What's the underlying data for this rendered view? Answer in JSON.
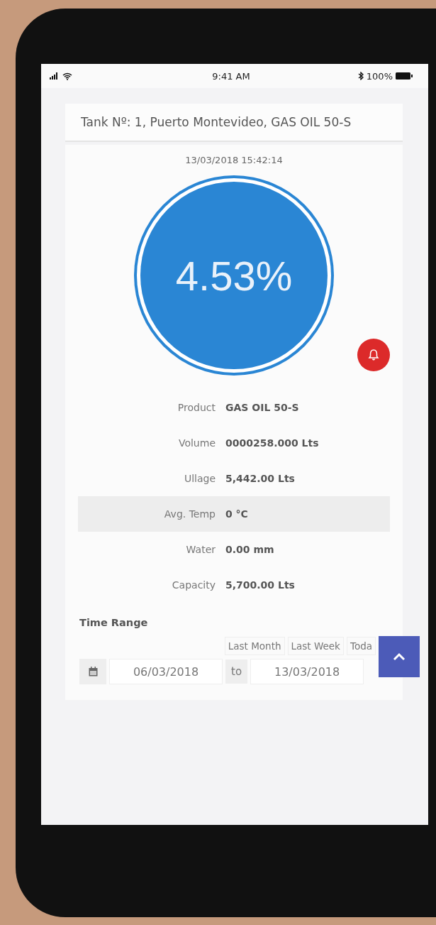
{
  "status_bar": {
    "time": "9:41 AM",
    "battery": "100%"
  },
  "tank_title": "Tank Nº: 1, Puerto Montevideo, GAS OIL 50-S",
  "timestamp": "13/03/2018 15:42:14",
  "gauge": {
    "percentage": "4.53%"
  },
  "details": [
    {
      "label": "Product",
      "value": "GAS OIL 50-S",
      "highlighted": false
    },
    {
      "label": "Volume",
      "value": "0000258.000 Lts",
      "highlighted": false
    },
    {
      "label": "Ullage",
      "value": "5,442.00 Lts",
      "highlighted": false
    },
    {
      "label": "Avg. Temp",
      "value": "0 °C",
      "highlighted": true
    },
    {
      "label": "Water",
      "value": "0.00 mm",
      "highlighted": false
    },
    {
      "label": "Capacity",
      "value": "5,700.00 Lts",
      "highlighted": false
    }
  ],
  "time_range": {
    "heading": "Time Range",
    "presets": [
      {
        "label": "Last Month"
      },
      {
        "label": "Last Week"
      },
      {
        "label": "Toda"
      }
    ],
    "from": "06/03/2018",
    "separator": "to",
    "to": "13/03/2018"
  }
}
